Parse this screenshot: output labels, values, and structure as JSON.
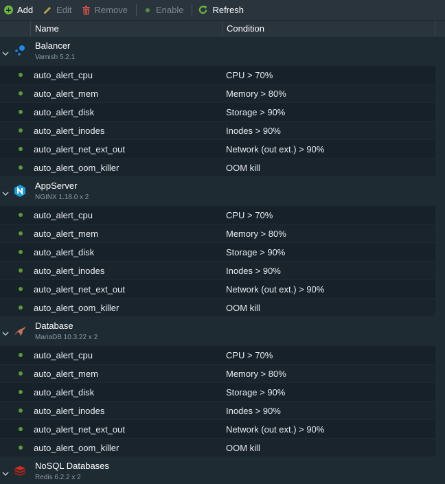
{
  "toolbar": {
    "add": "Add",
    "edit": "Edit",
    "remove": "Remove",
    "enable": "Enable",
    "refresh": "Refresh"
  },
  "columns": {
    "name": "Name",
    "condition": "Condition"
  },
  "colors": {
    "accent_green": "#6cb33f",
    "status_dot": "#5a9a3c",
    "nginx": "#1a9bd7",
    "redis": "#d82c20",
    "mariadb": "#c0765a"
  },
  "groups": [
    {
      "title": "Balancer",
      "subtitle": "Varnish 5.2.1",
      "icon": "varnish-icon",
      "alerts": [
        {
          "name": "auto_alert_cpu",
          "condition": "CPU > 70%"
        },
        {
          "name": "auto_alert_mem",
          "condition": "Memory > 80%"
        },
        {
          "name": "auto_alert_disk",
          "condition": "Storage > 90%"
        },
        {
          "name": "auto_alert_inodes",
          "condition": "Inodes > 90%"
        },
        {
          "name": "auto_alert_net_ext_out",
          "condition": "Network (out ext.) > 90%"
        },
        {
          "name": "auto_alert_oom_killer",
          "condition": "OOM kill"
        }
      ]
    },
    {
      "title": "AppServer",
      "subtitle": "NGINX 1.18.0 x 2",
      "icon": "nginx-icon",
      "alerts": [
        {
          "name": "auto_alert_cpu",
          "condition": "CPU > 70%"
        },
        {
          "name": "auto_alert_mem",
          "condition": "Memory > 80%"
        },
        {
          "name": "auto_alert_disk",
          "condition": "Storage > 90%"
        },
        {
          "name": "auto_alert_inodes",
          "condition": "Inodes > 90%"
        },
        {
          "name": "auto_alert_net_ext_out",
          "condition": "Network (out ext.) > 90%"
        },
        {
          "name": "auto_alert_oom_killer",
          "condition": "OOM kill"
        }
      ]
    },
    {
      "title": "Database",
      "subtitle": "MariaDB 10.3.22 x 2",
      "icon": "mariadb-icon",
      "alerts": [
        {
          "name": "auto_alert_cpu",
          "condition": "CPU > 70%"
        },
        {
          "name": "auto_alert_mem",
          "condition": "Memory > 80%"
        },
        {
          "name": "auto_alert_disk",
          "condition": "Storage > 90%"
        },
        {
          "name": "auto_alert_inodes",
          "condition": "Inodes > 90%"
        },
        {
          "name": "auto_alert_net_ext_out",
          "condition": "Network (out ext.) > 90%"
        },
        {
          "name": "auto_alert_oom_killer",
          "condition": "OOM kill"
        }
      ]
    },
    {
      "title": "NoSQL Databases",
      "subtitle": "Redis 6.2.2 x 2",
      "icon": "redis-icon",
      "alerts": []
    }
  ]
}
